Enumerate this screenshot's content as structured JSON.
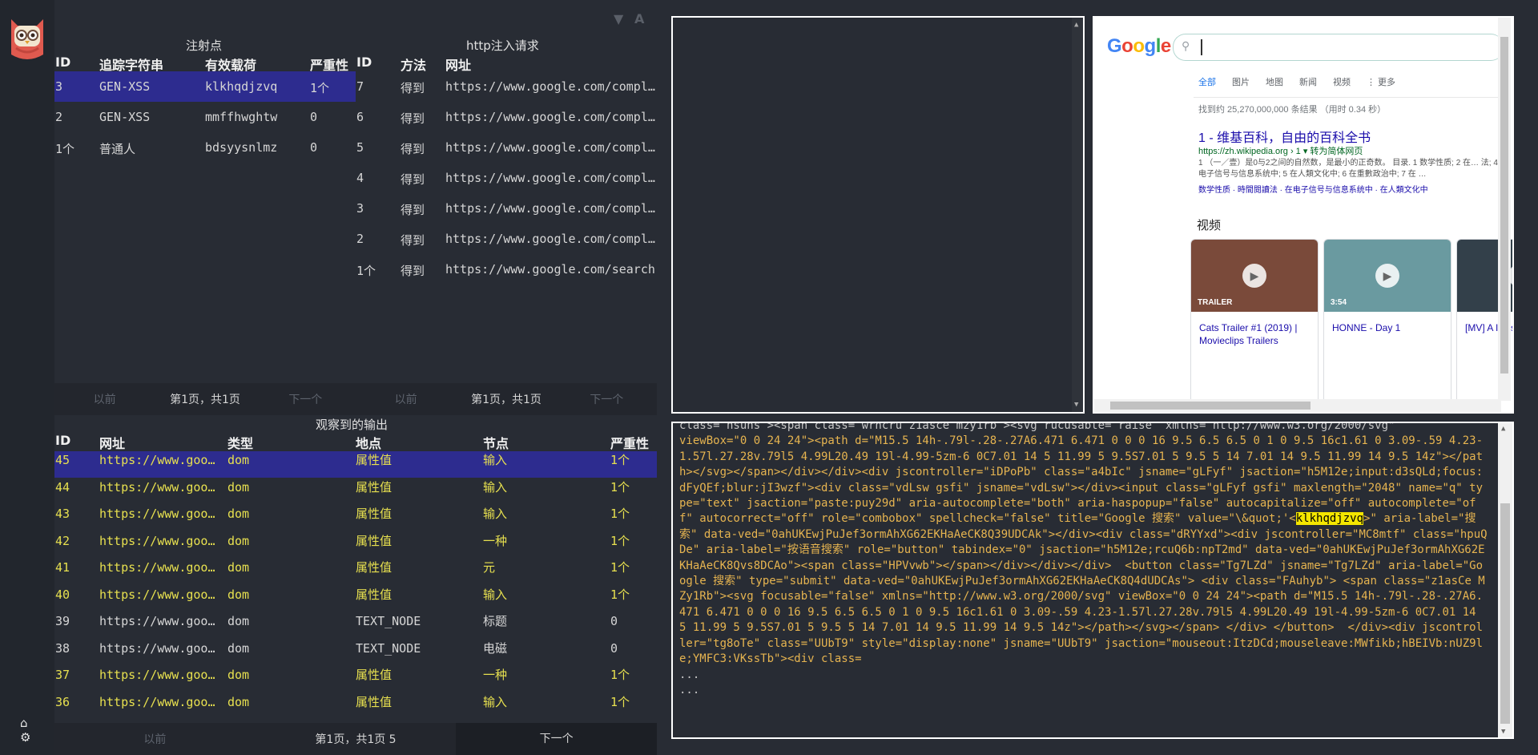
{
  "filter_icons": {
    "filter": "filter-icon",
    "font": "A"
  },
  "injection_table": {
    "caption": "注射点",
    "headers": [
      "ID",
      "追踪字符串",
      "有效载荷",
      "严重性"
    ],
    "rows": [
      {
        "id": "3",
        "tracker": "GEN-XSS",
        "payload": "klkhqdjzvq",
        "severity": "1个",
        "selected": true
      },
      {
        "id": "2",
        "tracker": "GEN-XSS",
        "payload": "mmffhwghtw",
        "severity": "0",
        "selected": false
      },
      {
        "id": "1个",
        "tracker": "普通人",
        "payload": "bdsyysnlmz",
        "severity": "0",
        "selected": false
      }
    ],
    "pager": {
      "prev": "以前",
      "page": "第1页，共1页",
      "next": "下一个"
    }
  },
  "request_table": {
    "caption": "http注入请求",
    "headers": [
      "ID",
      "方法",
      "网址"
    ],
    "rows": [
      {
        "id": "7",
        "method": "得到",
        "url": "https://www.google.com/complete/search"
      },
      {
        "id": "6",
        "method": "得到",
        "url": "https://www.google.com/complete/search"
      },
      {
        "id": "5",
        "method": "得到",
        "url": "https://www.google.com/complete/search"
      },
      {
        "id": "4",
        "method": "得到",
        "url": "https://www.google.com/complete/search"
      },
      {
        "id": "3",
        "method": "得到",
        "url": "https://www.google.com/complete/search"
      },
      {
        "id": "2",
        "method": "得到",
        "url": "https://www.google.com/complete/search"
      },
      {
        "id": "1个",
        "method": "得到",
        "url": "https://www.google.com/search"
      }
    ],
    "pager": {
      "prev": "以前",
      "page": "第1页，共1页",
      "next": "下一个"
    }
  },
  "output_table": {
    "caption": "观察到的输出",
    "headers": [
      "ID",
      "网址",
      "类型",
      "地点",
      "节点",
      "严重性"
    ],
    "rows": [
      {
        "id": "45",
        "url": "https://www.google.com/",
        "type": "dom",
        "location": "属性值",
        "node": "输入",
        "severity": "1个",
        "hl": true,
        "selected": true
      },
      {
        "id": "44",
        "url": "https://www.google.com/",
        "type": "dom",
        "location": "属性值",
        "node": "输入",
        "severity": "1个",
        "hl": true,
        "selected": false
      },
      {
        "id": "43",
        "url": "https://www.google.com/",
        "type": "dom",
        "location": "属性值",
        "node": "输入",
        "severity": "1个",
        "hl": true,
        "selected": false
      },
      {
        "id": "42",
        "url": "https://www.google.com/",
        "type": "dom",
        "location": "属性值",
        "node": "一种",
        "severity": "1个",
        "hl": true,
        "selected": false
      },
      {
        "id": "41",
        "url": "https://www.google.com/",
        "type": "dom",
        "location": "属性值",
        "node": "元",
        "severity": "1个",
        "hl": true,
        "selected": false
      },
      {
        "id": "40",
        "url": "https://www.google.com/",
        "type": "dom",
        "location": "属性值",
        "node": "输入",
        "severity": "1个",
        "hl": true,
        "selected": false
      },
      {
        "id": "39",
        "url": "https://www.google.com/",
        "type": "dom",
        "location": "TEXT_NODE",
        "node": "标题",
        "severity": "0",
        "hl": false,
        "selected": false
      },
      {
        "id": "38",
        "url": "https://www.google.com/",
        "type": "dom",
        "location": "TEXT_NODE",
        "node": "电磁",
        "severity": "0",
        "hl": false,
        "selected": false
      },
      {
        "id": "37",
        "url": "https://www.google.com/",
        "type": "dom",
        "location": "属性值",
        "node": "一种",
        "severity": "1个",
        "hl": true,
        "selected": false
      },
      {
        "id": "36",
        "url": "https://www.google.com/",
        "type": "dom",
        "location": "属性值",
        "node": "输入",
        "severity": "1个",
        "hl": true,
        "selected": false
      }
    ],
    "pager": {
      "prev": "以前",
      "page": "第1页，共1页 5",
      "next": "下一个"
    }
  },
  "google": {
    "logo": "Google",
    "tabs": [
      "全部",
      "图片",
      "地图",
      "新闻",
      "视频",
      "⋮ 更多"
    ],
    "result_stats": "找到约 25,270,000,000 条结果 （用时 0.34 秒）",
    "result_title": "1 - 维基百科，自由的百科全书",
    "result_url": "https://zh.wikipedia.org › 1 ▾ 转为简体网页",
    "result_snippet": "1 （一／壹）是0与2之间的自然数，是最小的正奇数。 目录. 1 数学性质; 2 在… 法; 4 在电子信号与信息系统中; 5 在人類文化中; 6 在重數政治中; 7 在 …",
    "result_links": "数学性质 · 時間閱讀法 · 在电子信号与信息系统中 · 在人類文化中",
    "videos_heading": "视频",
    "videos": [
      {
        "title": "Cats Trailer #1 (2019) | Movieclips Trailers",
        "badge": "TRAILER"
      },
      {
        "title": "HONNE - Day 1",
        "badge": "3:54"
      },
      {
        "title": "[MV] A I'm so",
        "badge": ""
      }
    ]
  },
  "code": {
    "line0": "class= hsuns ><span class= wrncru z1asce mzy1rb ><svg rucusabte= raise  xmlns= http://www.w3.org/2000/svg\"",
    "line1": "viewBox=\"0 0 24 24\"><path d=\"M15.5 14h-.79l-.28-.27A6.471 6.471 0 0 0 16 9.5 6.5 6.5 0 1 0 9.5 16c1.61 0 3.09-.59 4.23-1.57l.27.28v.79l5 4.99L20.49 19l-4.99-5zm-6 0C7.01 14 5 11.99 5 9.5S7.01 5 9.5 5 14 7.01 14 9.5 11.99 14 9.5 14z\"></path></svg></span></div></div><div jscontroller=\"iDPoPb\" class=\"a4bIc\" jsname=\"gLFyf\" jsaction=\"h5M12e;input:d3sQLd;focus:dFyQEf;blur:jI3wzf\"><div class=\"vdLsw gsfi\" jsname=\"vdLsw\"></div><input class=\"gLFyf gsfi\" maxlength=\"2048\" name=\"q\" type=\"text\" jsaction=\"paste:puy29d\" aria-autocomplete=\"both\" aria-haspopup=\"false\" autocapitalize=\"off\" autocomplete=\"off\" autocorrect=\"off\" role=\"combobox\" spellcheck=\"false\" title=\"Google 搜索\" value=\"\\&quot;'<",
    "payload": "klkhqdjzvq",
    "line2": ">\" aria-label=\"搜索\" data-ved=\"0ahUKEwjPuJef3ormAhXG62EKHaAeCK8Q39UDCAk\"></div><div class=\"dRYYxd\"><div jscontroller=\"MC8mtf\" class=\"hpuQDe\" aria-label=\"按语音搜索\" role=\"button\" tabindex=\"0\" jsaction=\"h5M12e;rcuQ6b:npT2md\" data-ved=\"0ahUKEwjPuJef3ormAhXG62EKHaAeCK8Qvs8DCAo\"><span class=\"HPVvwb\"></span></div></div></div>  <button class=\"Tg7LZd\" jsname=\"Tg7LZd\" aria-label=\"Google 搜索\" type=\"submit\" data-ved=\"0ahUKEwjPuJef3ormAhXG62EKHaAeCK8Q4dUDCAs\"> <div class=\"FAuhyb\"> <span class=\"z1asCe MZy1Rb\"><svg focusable=\"false\" xmlns=\"http://www.w3.org/2000/svg\" viewBox=\"0 0 24 24\"><path d=\"M15.5 14h-.79l-.28-.27A6.471 6.471 0 0 0 16 9.5 6.5 6.5 0 1 0 9.5 16c1.61 0 3.09-.59 4.23-1.57l.27.28v.79l5 4.99L20.49 19l-4.99-5zm-6 0C7.01 14 5 11.99 5 9.5S7.01 5 9.5 5 14 7.01 14 9.5 11.99 14 9.5 14z\"></path></svg></span> </div> </button>  </div><div jscontroller=\"tg8oTe\" class=\"UUbT9\" style=\"display:none\" jsname=\"UUbT9\" jsaction=\"mouseout:ItzDCd;mouseleave:MWfikb;hBEIVb:nUZ9le;YMFC3:VKssTb\"><div class=",
    "ellipsis1": "...",
    "ellipsis2": "..."
  }
}
